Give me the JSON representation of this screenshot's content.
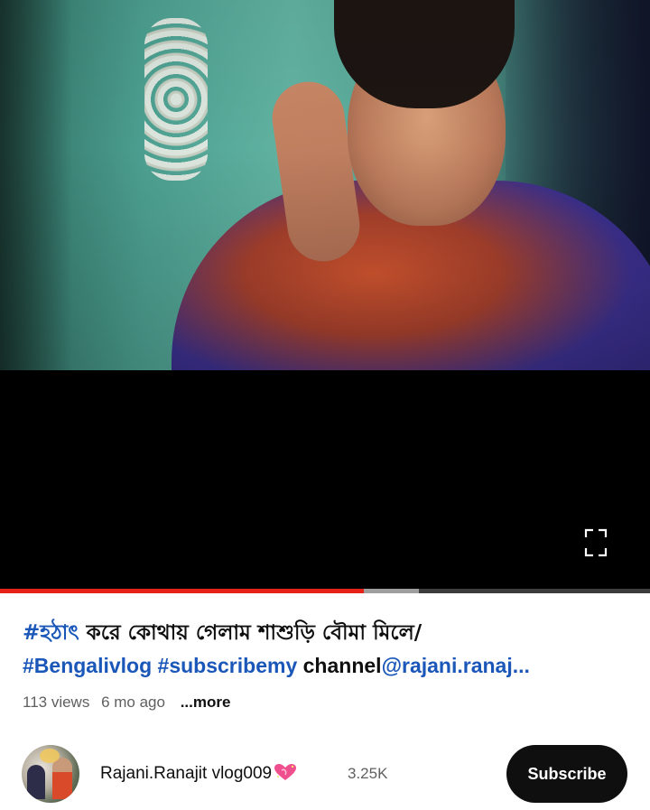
{
  "video": {
    "progress_played": 0.56,
    "progress_buffered": 0.645,
    "fullscreen_icon": "fullscreen-icon"
  },
  "title": {
    "hashtag_bn": "#হঠাৎ",
    "text_bn": " করে কোথায় গেলাম শাশুড়ি বৌমা মিলে/",
    "hashtag_vlog": "#Bengalivlog",
    "space": " ",
    "hashtag_sub": "#subscribemy",
    "channel_word": " channel",
    "mention": "@rajani.ranaj..."
  },
  "meta": {
    "views": "113 views",
    "age": "6 mo ago",
    "more": "...more"
  },
  "channel": {
    "name": "Rajani.Ranajit vlog009",
    "emoji": "sparkling-heart-icon",
    "subscribers": "3.25K",
    "subscribe_label": "Subscribe"
  },
  "colors": {
    "progress_played": "#e62117",
    "hashtag": "#1a57b8",
    "subscribe_bg": "#0f0f0f"
  }
}
